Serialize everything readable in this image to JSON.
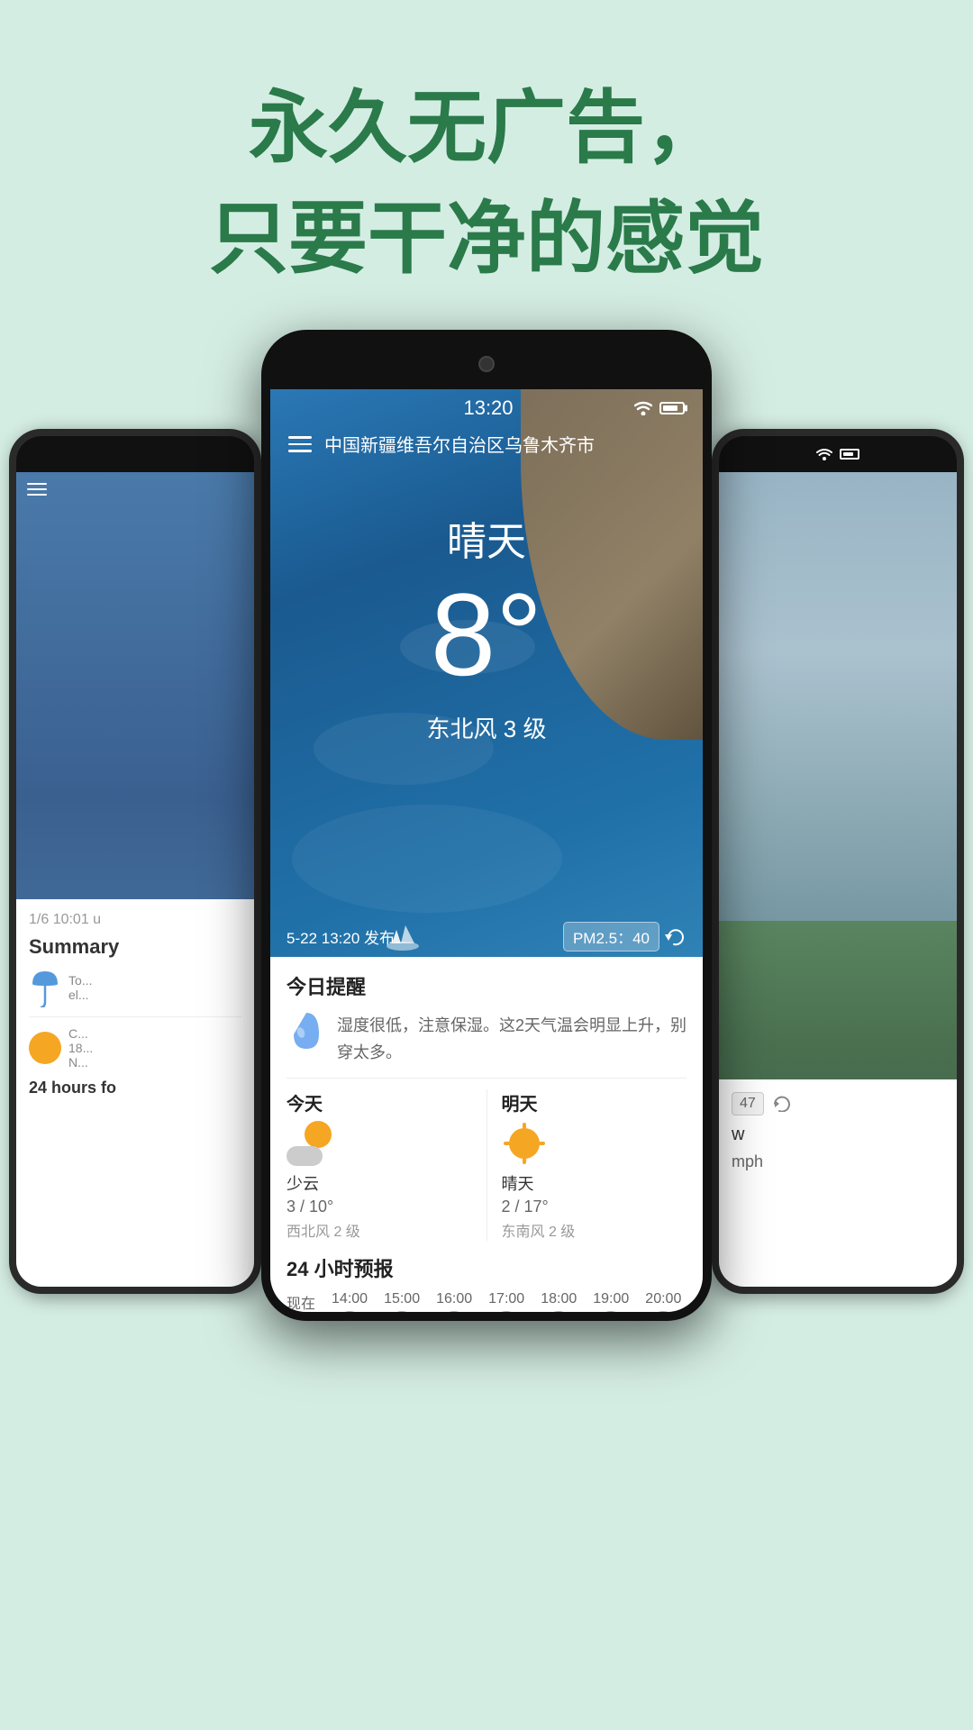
{
  "hero": {
    "line1": "永久无广告，",
    "line2": "只要干净的感觉",
    "color": "#2a7a4a"
  },
  "phone_center": {
    "status": {
      "time": "13:20",
      "wifi": "wifi",
      "battery": "battery"
    },
    "location": "中国新疆维吾尔自治区乌鲁木齐市",
    "weather": {
      "condition": "晴天",
      "temperature": "8°",
      "wind": "东北风 3 级"
    },
    "publish_time": "5-22 13:20 发布",
    "pm25": "PM2.5：40",
    "today_reminder_title": "今日提醒",
    "reminder_text": "湿度很低，注意保湿。这2天气温会明显上升，别穿太多。",
    "forecast": [
      {
        "day": "今天",
        "condition": "少云",
        "temp": "3 / 10°",
        "wind": "西北风 2 级"
      },
      {
        "day": "明天",
        "condition": "晴天",
        "temp": "2 / 17°",
        "wind": "东南风 2 级"
      }
    ],
    "hours_title": "24 小时预报",
    "hours": [
      {
        "time": "现在"
      },
      {
        "time": "14:00"
      },
      {
        "time": "15:00"
      },
      {
        "time": "16:00"
      },
      {
        "time": "17:00"
      },
      {
        "time": "18:00"
      },
      {
        "time": "19:00"
      },
      {
        "time": "20:00"
      }
    ]
  },
  "phone_left": {
    "date_label": "1/6 10:01 u",
    "summary_label": "Summary",
    "today_text": "To... el...",
    "today_forecast_label": "24 hours fo"
  },
  "phone_right": {
    "badge_label": "47",
    "wind_label": "w",
    "speed_label": "mph"
  }
}
